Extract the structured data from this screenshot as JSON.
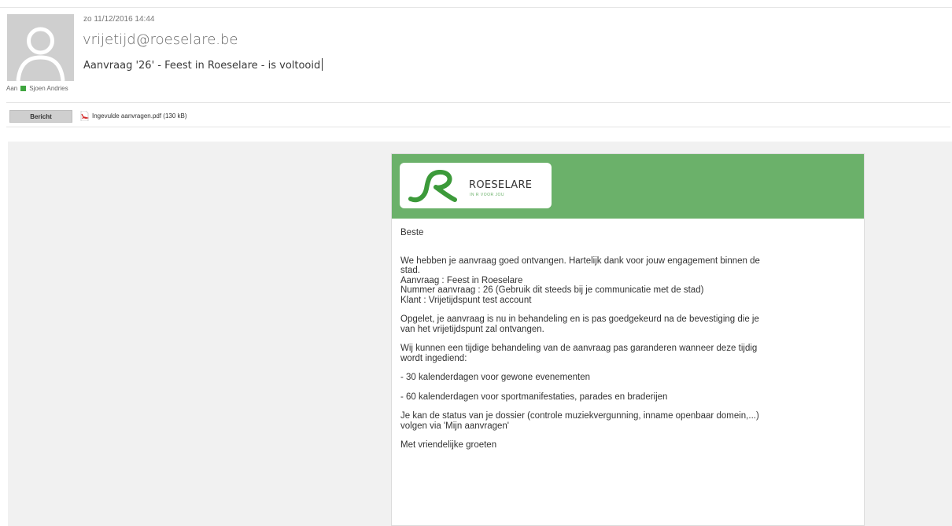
{
  "message": {
    "date": "zo 11/12/2016 14:44",
    "sender": "vrijetijd@roeselare.be",
    "subject": "Aanvraag '26' - Feest in Roeselare - is voltooid",
    "to_label": "Aan",
    "to_name": "Sjoen Andries"
  },
  "attachments": {
    "tab_label": "Bericht",
    "file_name": "Ingevulde aanvragen.pdf (130 kB)"
  },
  "card": {
    "logo_text": "ROESELARE",
    "logo_tagline": "IN R VOOR JOU",
    "accent_color": "#6bb16a",
    "greeting": "Beste",
    "para1_line1": "We hebben je aanvraag goed ontvangen. Hartelijk dank voor jouw engagement binnen de",
    "para1_line2": "stad.",
    "detail_aanvraag": "Aanvraag : Feest in Roeselare",
    "detail_nummer": "Nummer aanvraag : 26 (Gebruik dit steeds bij je communicatie met de stad)",
    "detail_klant": "Klant : Vrijetijdspunt test account",
    "para2_line1": "Opgelet, je aanvraag is nu in behandeling en is pas goedgekeurd na de bevestiging die je",
    "para2_line2": "van het vrijetijdspunt zal ontvangen.",
    "para3_line1": "Wij kunnen een tijdige behandeling van de aanvraag pas garanderen wanneer deze tijdig",
    "para3_line2": "wordt ingediend:",
    "bullet1": "- 30 kalenderdagen voor gewone evenementen",
    "bullet2": "- 60 kalenderdagen voor sportmanifestaties, parades en braderijen",
    "para4_line1": "Je kan de status van je dossier (controle muziekvergunning, inname openbaar domein,...)",
    "para4_line2": "volgen via 'Mijn aanvragen'",
    "closing": "Met vriendelijke groeten"
  }
}
